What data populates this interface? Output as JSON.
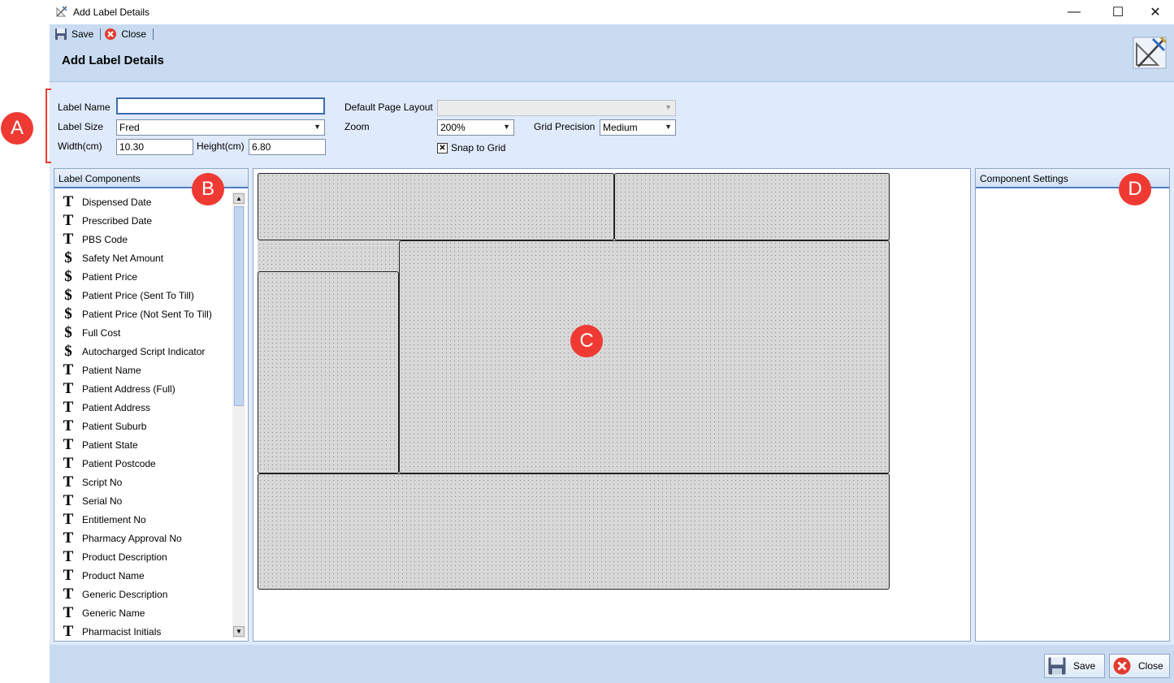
{
  "window": {
    "title": "Add Label Details",
    "minimize_glyph": "—",
    "maximize_glyph": "☐",
    "close_glyph": "✕"
  },
  "toolbar": {
    "save_label": "Save",
    "close_label": "Close"
  },
  "header": {
    "page_title": "Add Label Details"
  },
  "form": {
    "label_name": {
      "label": "Label Name",
      "value": ""
    },
    "label_size": {
      "label": "Label Size",
      "value": "Fred"
    },
    "width": {
      "label": "Width(cm)",
      "value": "10.30"
    },
    "height": {
      "label": "Height(cm)",
      "value": "6.80"
    },
    "default_page_layout": {
      "label": "Default Page Layout",
      "value": ""
    },
    "zoom": {
      "label": "Zoom",
      "value": "200%"
    },
    "grid_precision": {
      "label": "Grid Precision",
      "value": "Medium"
    },
    "snap_to_grid": {
      "label": "Snap to Grid",
      "checked": true,
      "mark": "✕"
    }
  },
  "label_components": {
    "title": "Label Components",
    "items": [
      {
        "icon": "T",
        "label": "Dispensed Date"
      },
      {
        "icon": "T",
        "label": "Prescribed Date"
      },
      {
        "icon": "T",
        "label": "PBS Code"
      },
      {
        "icon": "$",
        "label": "Safety Net Amount"
      },
      {
        "icon": "$",
        "label": "Patient Price"
      },
      {
        "icon": "$",
        "label": "Patient Price (Sent To Till)"
      },
      {
        "icon": "$",
        "label": "Patient Price (Not Sent To Till)"
      },
      {
        "icon": "$",
        "label": "Full Cost"
      },
      {
        "icon": "$",
        "label": "Autocharged Script Indicator"
      },
      {
        "icon": "T",
        "label": "Patient Name"
      },
      {
        "icon": "T",
        "label": "Patient Address (Full)"
      },
      {
        "icon": "T",
        "label": "Patient Address"
      },
      {
        "icon": "T",
        "label": "Patient Suburb"
      },
      {
        "icon": "T",
        "label": "Patient State"
      },
      {
        "icon": "T",
        "label": "Patient Postcode"
      },
      {
        "icon": "T",
        "label": "Script No"
      },
      {
        "icon": "T",
        "label": "Serial No"
      },
      {
        "icon": "T",
        "label": "Entitlement No"
      },
      {
        "icon": "T",
        "label": "Pharmacy Approval No"
      },
      {
        "icon": "T",
        "label": "Product Description"
      },
      {
        "icon": "T",
        "label": "Product Name"
      },
      {
        "icon": "T",
        "label": "Generic Description"
      },
      {
        "icon": "T",
        "label": "Generic Name"
      },
      {
        "icon": "T",
        "label": "Pharmacist Initials"
      }
    ]
  },
  "component_settings": {
    "title": "Component Settings"
  },
  "bottom": {
    "save_label": "Save",
    "close_label": "Close"
  },
  "markers": {
    "a": "A",
    "b": "B",
    "c": "C",
    "d": "D"
  },
  "colors": {
    "marker": "#ee3a33",
    "header_bg": "#c8dbf1",
    "form_bg": "#dfeafa",
    "accent_border": "#4f7cc0"
  }
}
